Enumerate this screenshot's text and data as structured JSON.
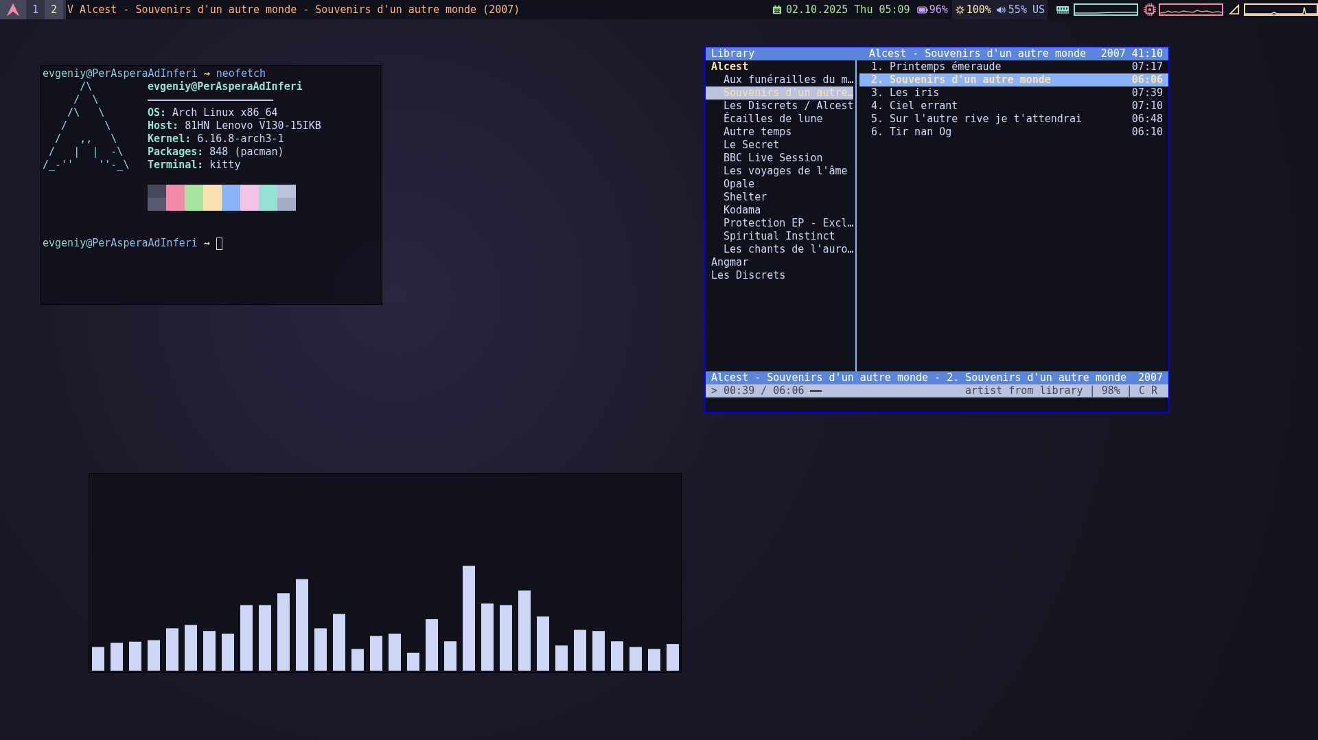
{
  "top_bar": {
    "workspaces": [
      {
        "label": "1",
        "selected": false
      },
      {
        "label": "2",
        "selected": true
      }
    ],
    "window_title": "V Alcest - Souvenirs d'un autre monde - Souvenirs d'un autre monde (2007)",
    "clock": "02.10.2025 Thu 05:09",
    "battery": "96%",
    "brightness": "100%",
    "volume": "55%",
    "keyboard_layout": "US"
  },
  "terminal": {
    "prompt": "evgeniy@PerAsperaAdInferi",
    "arrow": "⇝",
    "command": "neofetch",
    "logo": [
      "      /\\",
      "     /  \\",
      "    /\\   \\",
      "   /      \\",
      "  /   ,,   \\",
      " /   |  |  -\\",
      "/_-''    ''-_\\"
    ],
    "title": "evgeniy@PerAsperaAdInferi",
    "info": [
      {
        "key": "OS:",
        "value": "Arch Linux x86_64"
      },
      {
        "key": "Host:",
        "value": "81HN Lenovo V130-15IKB"
      },
      {
        "key": "Kernel:",
        "value": "6.16.8-arch3-1"
      },
      {
        "key": "Packages:",
        "value": "848 (pacman)"
      },
      {
        "key": "Terminal:",
        "value": "kitty"
      }
    ],
    "palette": [
      {
        "color": "#45475a"
      },
      {
        "color": "#f38ba8"
      },
      {
        "color": "#a6e3a1"
      },
      {
        "color": "#f9e2af"
      },
      {
        "color": "#89b4fa"
      },
      {
        "color": "#f5c2e7"
      },
      {
        "color": "#94e2d5"
      },
      {
        "color": "#bac2de"
      },
      {
        "color": "#585b70"
      },
      {
        "color": "#f38ba8"
      },
      {
        "color": "#a6e3a1"
      },
      {
        "color": "#f9e2af"
      },
      {
        "color": "#89b4fa"
      },
      {
        "color": "#f5c2e7"
      },
      {
        "color": "#94e2d5"
      },
      {
        "color": "#a6adc8"
      }
    ],
    "prompt_2": "evgeniy@PerAsperaAdInferi",
    "arrow_2": "⇝"
  },
  "music_player": {
    "header": {
      "left": "Library",
      "center": "Alcest - Souvenirs d'un autre monde",
      "right": "2007 41:10"
    },
    "library": [
      {
        "name": "Alcest",
        "current": true,
        "children": [
          {
            "name": "Aux funérailles du m…",
            "selected": false
          },
          {
            "name": "Souvenirs d'un autre…",
            "selected": true
          },
          {
            "name": "Les Discrets / Alcest",
            "selected": false
          },
          {
            "name": "Écailles de lune",
            "selected": false
          },
          {
            "name": "Autre temps",
            "selected": false
          },
          {
            "name": "Le Secret",
            "selected": false
          },
          {
            "name": "BBC Live Session",
            "selected": false
          },
          {
            "name": "Les voyages de l'âme",
            "selected": false
          },
          {
            "name": "Opale",
            "selected": false
          },
          {
            "name": "Shelter",
            "selected": false
          },
          {
            "name": "Kodama",
            "selected": false
          },
          {
            "name": "Protection EP - Excl…",
            "selected": false
          },
          {
            "name": "Spiritual Instinct",
            "selected": false
          },
          {
            "name": "Les chants de l'auro…",
            "selected": false
          }
        ]
      },
      {
        "name": "Angmar",
        "current": false
      },
      {
        "name": "Les Discrets",
        "current": false
      }
    ],
    "tracks": [
      {
        "number": "1.",
        "title": "Printemps émeraude",
        "duration": "07:17",
        "selected": false
      },
      {
        "number": "2.",
        "title": "Souvenirs d'un autre monde",
        "duration": "06:06",
        "selected": true
      },
      {
        "number": "3.",
        "title": "Les iris",
        "duration": "07:39",
        "selected": false
      },
      {
        "number": "4.",
        "title": "Ciel errant",
        "duration": "07:10",
        "selected": false
      },
      {
        "number": "5.",
        "title": "Sur l'autre rive je t'attendrai",
        "duration": "06:48",
        "selected": false
      },
      {
        "number": "6.",
        "title": "Tir nan Og",
        "duration": "06:10",
        "selected": false
      }
    ],
    "now_playing": {
      "text": "Alcest - Souvenirs d'un autre monde - 2. Souvenirs d'un autre monde",
      "year": "2007"
    },
    "status": {
      "position": "> 00:39 / 06:06",
      "right": "artist from library | 98% | C R"
    }
  }
}
